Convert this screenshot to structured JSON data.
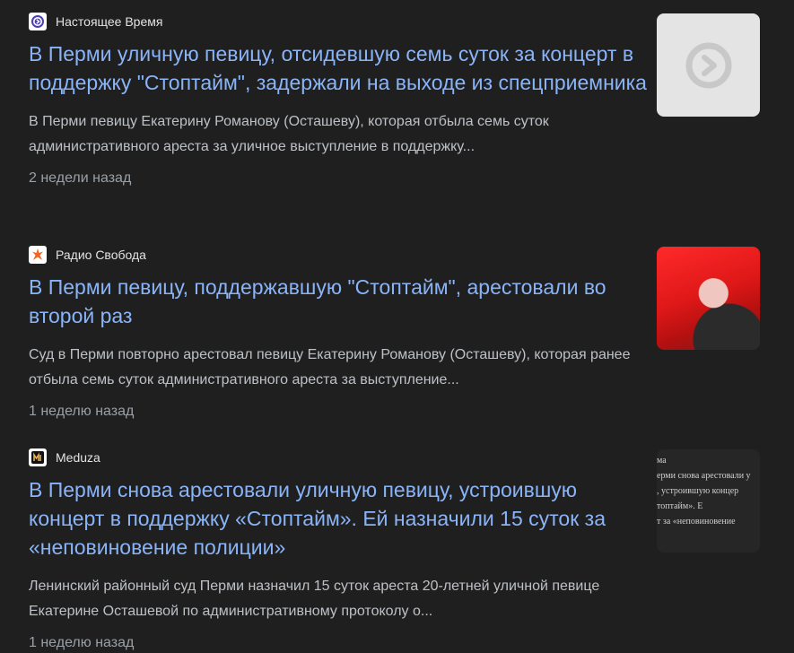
{
  "results": [
    {
      "source": "Настоящее Время",
      "favicon": "current-time-logo-icon",
      "headline": "В Перми уличную певицу, отсидевшую семь суток за концерт в поддержку \"Стоптайм\", задержали на выходе из спецприемника",
      "snippet": "В Перми певицу Екатерину Романову (Осташеву), которая отбыла семь суток административного ареста за уличное выступление в поддержку...",
      "time": "2 недели назад",
      "thumbnail": "current-time-logo-thumbnail"
    },
    {
      "source": "Радио Свобода",
      "favicon": "radio-liberty-logo-icon",
      "headline": "В Перми певицу, поддержавшую \"Стоптайм\", арестовали во второй раз",
      "snippet": "Суд в Перми повторно арестовал певицу Екатерину Романову (Осташеву), которая ранее отбыла семь суток административного ареста за выступление...",
      "time": "1 неделю назад",
      "thumbnail": "red-haired-singer-photo"
    },
    {
      "source": "Meduza",
      "favicon": "meduza-logo-icon",
      "headline": "В Перми снова арестовали уличную певицу, устроившую концерт в поддержку «Стоптайм». Ей назначили 15 суток за «неповиновение полиции»",
      "snippet": "Ленинский районный суд Перми назначил 15 суток ареста 20-летней уличной певице Екатерине Осташевой по административному протоколу о...",
      "time": "1 неделю назад",
      "thumbnail": "meduza-article-text-thumbnail",
      "thumbnail_text": [
        "ма",
        "ерми снова арестовали у",
        ", устроившую концер",
        "топтайм». Е",
        "т за «неповиновение"
      ]
    }
  ],
  "colors": {
    "background": "#1f1f1f",
    "headline": "#8ab4f8",
    "snippet": "#bdc1c6",
    "time": "#9aa0a6",
    "source": "#e3e3e3"
  }
}
